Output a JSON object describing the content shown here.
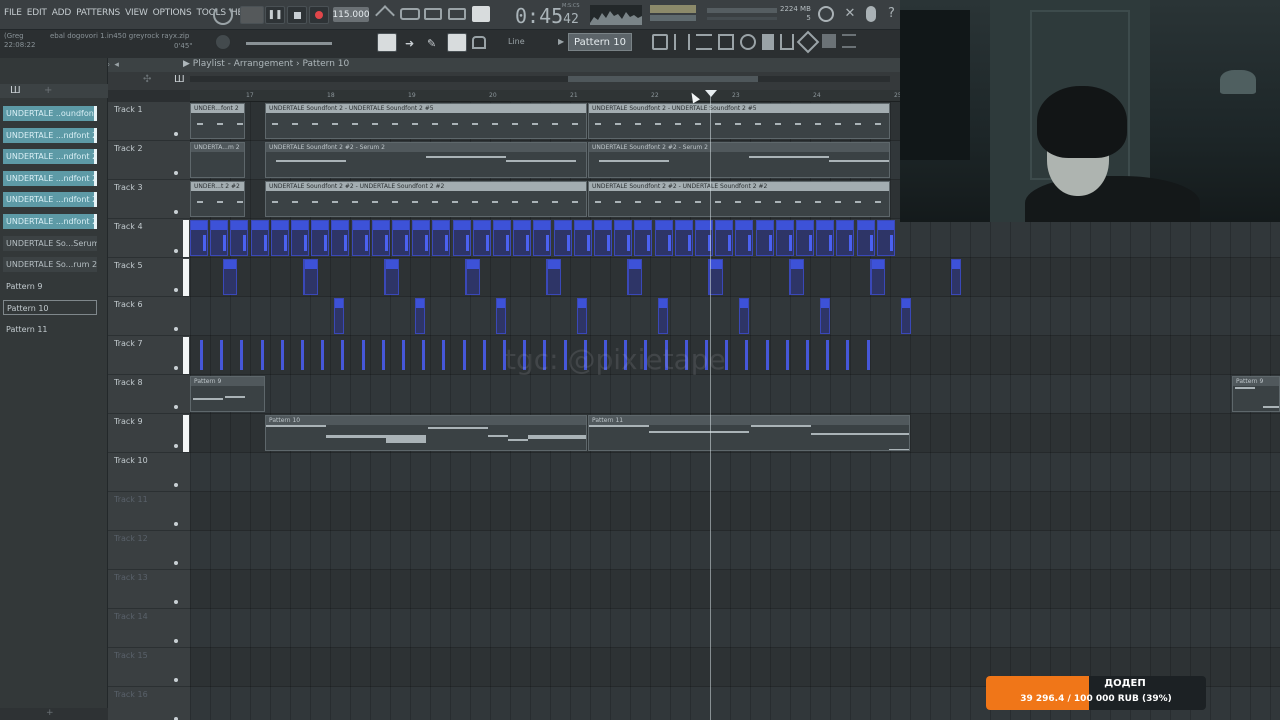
{
  "menu": {
    "items": [
      "FILE",
      "EDIT",
      "ADD",
      "PATTERNS",
      "VIEW",
      "OPTIONS",
      "TOOLS",
      "HELP"
    ]
  },
  "hint": {
    "user": "(Greg",
    "file": "ebal dogovori 1.in450 greyrock rayx.zip",
    "clock": "22:08:22",
    "offset": "0'45\""
  },
  "transport": {
    "tempo": "115.000",
    "time_main": "0:45",
    "time_small": "42",
    "time_unit": "M:S:CS",
    "mem_top": "2224 MB",
    "mem_bottom": "5"
  },
  "toolbar": {
    "snap": "Line",
    "pattern": "Pattern 10"
  },
  "playlist": {
    "title": "Playlist - Arrangement",
    "pattern": "Pattern 10",
    "ruler": [
      "17",
      "18",
      "19",
      "20",
      "21",
      "22",
      "23",
      "24",
      "25"
    ]
  },
  "picker": {
    "items": [
      {
        "label": "UNDERTALE ..oundfont 2",
        "kind": "audio"
      },
      {
        "label": "UNDERTALE ...ndfont 2 #5",
        "kind": "audio"
      },
      {
        "label": "UNDERTALE ...ndfont 2 #4",
        "kind": "audio"
      },
      {
        "label": "UNDERTALE ...ndfont 2 #2",
        "kind": "audio"
      },
      {
        "label": "UNDERTALE ...ndfont 2 #3",
        "kind": "audio"
      },
      {
        "label": "UNDERTALE ...ndfont 2 #",
        "kind": "audio"
      },
      {
        "label": "UNDERTALE So...Serum 2",
        "kind": "alt"
      },
      {
        "label": "UNDERTALE So...rum 2 #2",
        "kind": "alt"
      },
      {
        "label": "Pattern 9",
        "kind": "pat"
      },
      {
        "label": "Pattern 10",
        "kind": "pat-sel"
      },
      {
        "label": "Pattern 11",
        "kind": "pat"
      }
    ]
  },
  "tracks": [
    {
      "label": "Track 1"
    },
    {
      "label": "Track 2"
    },
    {
      "label": "Track 3"
    },
    {
      "label": "Track 4"
    },
    {
      "label": "Track 5"
    },
    {
      "label": "Track 6"
    },
    {
      "label": "Track 7"
    },
    {
      "label": "Track 8"
    },
    {
      "label": "Track 9"
    },
    {
      "label": "Track 10"
    },
    {
      "label": "Track 11"
    },
    {
      "label": "Track 12"
    },
    {
      "label": "Track 13"
    },
    {
      "label": "Track 14"
    },
    {
      "label": "Track 15"
    },
    {
      "label": "Track 16"
    }
  ],
  "clips": {
    "t1a": "UNDER...font 2",
    "t1b": "UNDERTALE Soundfont 2 - UNDERTALE Soundfont 2 #5",
    "t1c": "UNDERTALE Soundfont 2 - UNDERTALE Soundfont 2 #5",
    "t2a": "UNDERTA...m 2",
    "t2b": "UNDERTALE Soundfont 2 #2 - Serum 2",
    "t2c": "UNDERTALE Soundfont 2 #2 - Serum 2",
    "t3a": "UNDER...t 2 #2",
    "t3b": "UNDERTALE Soundfont 2 #2 - UNDERTALE Soundfont 2 #2",
    "t3c": "UNDERTALE Soundfont 2 #2 - UNDERTALE Soundfont 2 #2",
    "t8a": "Pattern 9",
    "t8b": "Pattern 9",
    "t9a": "Pattern 10",
    "t9b": "Pattern 11"
  },
  "overlay": {
    "watermark": "tgc: @pixietape",
    "donate_label": "ДОДЕП",
    "donate_amount": "39 296.4 / 100 000 RUB (39%)",
    "donate_progress": 0.39
  },
  "colors": {
    "accent": "#f07618",
    "clip_blue": "#3d52d8",
    "clip_head": "#a3adb1",
    "picker_item": "#5d9aa6"
  }
}
